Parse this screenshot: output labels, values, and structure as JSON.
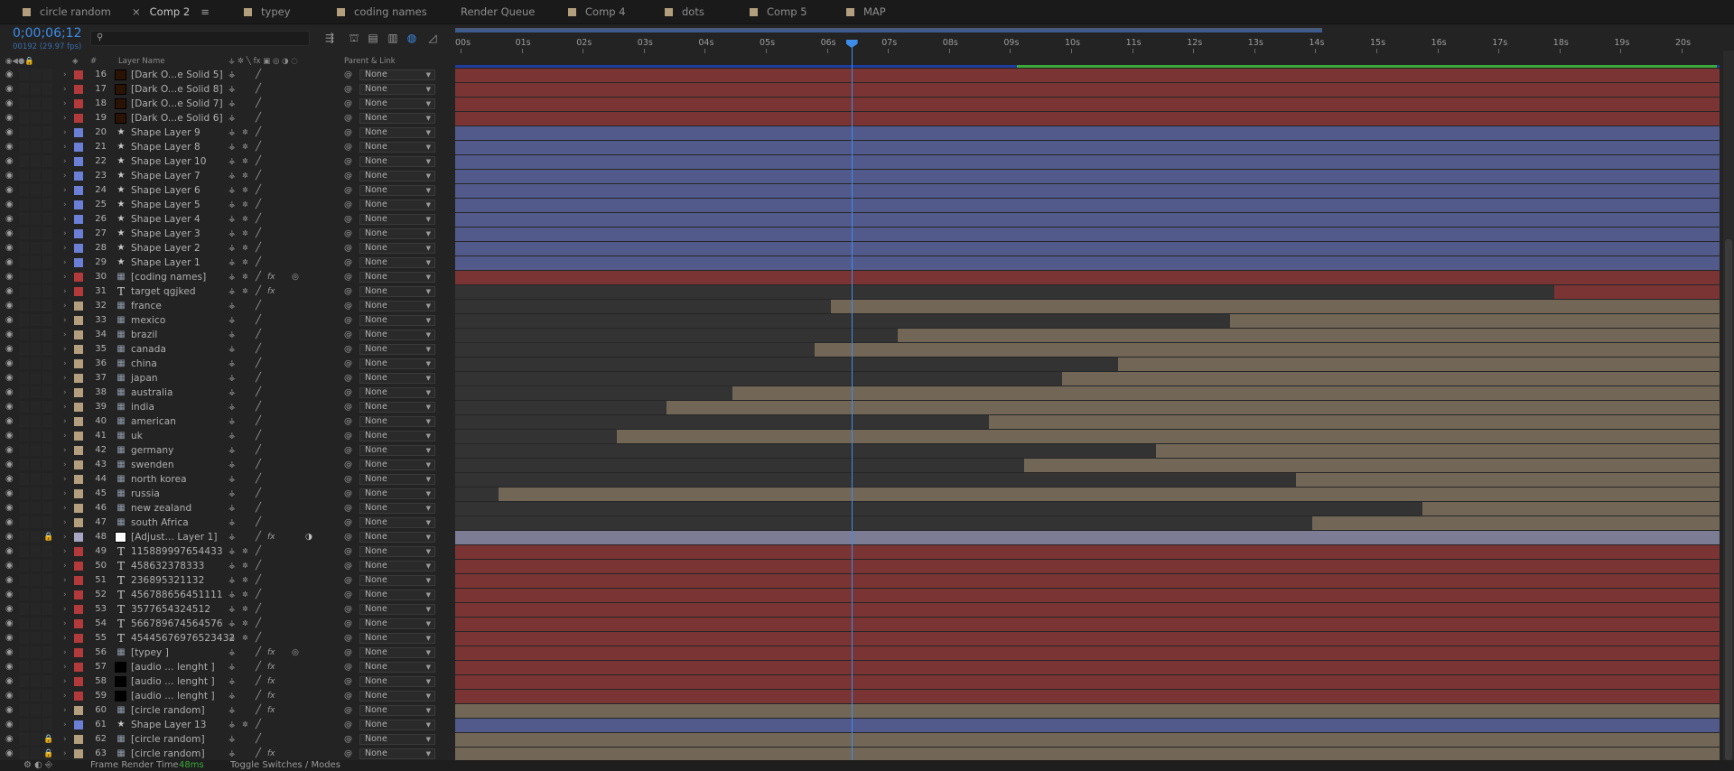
{
  "tabs": [
    {
      "label": "circle random",
      "color": "#b39f7d",
      "active": false
    },
    {
      "label": "Comp 2",
      "color": "#b39f7d",
      "active": true
    },
    {
      "label": "typey",
      "color": "#b39f7d",
      "active": false
    },
    {
      "label": "coding names",
      "color": "#b39f7d",
      "active": false
    },
    {
      "label": "Render Queue",
      "color": "",
      "active": false
    },
    {
      "label": "Comp 4",
      "color": "#b39f7d",
      "active": false
    },
    {
      "label": "dots",
      "color": "#b39f7d",
      "active": false
    },
    {
      "label": "Comp 5",
      "color": "#b39f7d",
      "active": false
    },
    {
      "label": "MAP",
      "color": "#b39f7d",
      "active": false
    }
  ],
  "header": {
    "timecode": "0;00;06;12",
    "frame_info": "00192 (29.97 fps)",
    "search_placeholder": ""
  },
  "columns": {
    "hash": "#",
    "layer_name": "Layer Name",
    "parent_link": "Parent & Link"
  },
  "ruler_ticks": [
    "00s",
    "01s",
    "02s",
    "03s",
    "04s",
    "05s",
    "06s",
    "07s",
    "08s",
    "09s",
    "10s",
    "11s",
    "12s",
    "13s",
    "14s",
    "15s",
    "16s",
    "17s",
    "18s",
    "19s",
    "20s"
  ],
  "playhead_seconds": 6.4,
  "duration_seconds": 20.6,
  "layers": [
    {
      "num": "16",
      "name": "[Dark O...e Solid 5]",
      "icon": "solid",
      "label": "#b23a3a",
      "sw": "solid",
      "fx": false,
      "bar": {
        "start": 0,
        "end": 1,
        "color": "#7a3434"
      }
    },
    {
      "num": "17",
      "name": "[Dark O...e Solid 8]",
      "icon": "solid",
      "label": "#b23a3a",
      "sw": "solid",
      "fx": false,
      "bar": {
        "start": 0,
        "end": 1,
        "color": "#7a3434"
      }
    },
    {
      "num": "18",
      "name": "[Dark O...e Solid 7]",
      "icon": "solid",
      "label": "#b23a3a",
      "sw": "solid",
      "fx": false,
      "bar": {
        "start": 0,
        "end": 1,
        "color": "#7a3434"
      }
    },
    {
      "num": "19",
      "name": "[Dark O...e Solid 6]",
      "icon": "solid",
      "label": "#b23a3a",
      "sw": "solid",
      "fx": false,
      "bar": {
        "start": 0,
        "end": 1,
        "color": "#7a3434"
      }
    },
    {
      "num": "20",
      "name": "Shape Layer 9",
      "icon": "star",
      "label": "#6b7fd6",
      "sw": "shape",
      "fx": false,
      "bar": {
        "start": 0,
        "end": 1,
        "color": "#515a8a"
      }
    },
    {
      "num": "21",
      "name": "Shape Layer 8",
      "icon": "star",
      "label": "#6b7fd6",
      "sw": "shape",
      "fx": false,
      "bar": {
        "start": 0,
        "end": 1,
        "color": "#515a8a"
      }
    },
    {
      "num": "22",
      "name": "Shape Layer 10",
      "icon": "star",
      "label": "#6b7fd6",
      "sw": "shape",
      "fx": false,
      "bar": {
        "start": 0,
        "end": 1,
        "color": "#515a8a"
      }
    },
    {
      "num": "23",
      "name": "Shape Layer 7",
      "icon": "star",
      "label": "#6b7fd6",
      "sw": "shape",
      "fx": false,
      "bar": {
        "start": 0,
        "end": 1,
        "color": "#515a8a"
      }
    },
    {
      "num": "24",
      "name": "Shape Layer 6",
      "icon": "star",
      "label": "#6b7fd6",
      "sw": "shape",
      "fx": false,
      "bar": {
        "start": 0,
        "end": 1,
        "color": "#515a8a"
      }
    },
    {
      "num": "25",
      "name": "Shape Layer 5",
      "icon": "star",
      "label": "#6b7fd6",
      "sw": "shape",
      "fx": false,
      "bar": {
        "start": 0,
        "end": 1,
        "color": "#515a8a"
      }
    },
    {
      "num": "26",
      "name": "Shape Layer 4",
      "icon": "star",
      "label": "#6b7fd6",
      "sw": "shape",
      "fx": false,
      "bar": {
        "start": 0,
        "end": 1,
        "color": "#515a8a"
      }
    },
    {
      "num": "27",
      "name": "Shape Layer 3",
      "icon": "star",
      "label": "#6b7fd6",
      "sw": "shape",
      "fx": false,
      "bar": {
        "start": 0,
        "end": 1,
        "color": "#515a8a"
      }
    },
    {
      "num": "28",
      "name": "Shape Layer 2",
      "icon": "star",
      "label": "#6b7fd6",
      "sw": "shape",
      "fx": false,
      "bar": {
        "start": 0,
        "end": 1,
        "color": "#515a8a"
      }
    },
    {
      "num": "29",
      "name": "Shape Layer 1",
      "icon": "star",
      "label": "#6b7fd6",
      "sw": "shape",
      "fx": false,
      "bar": {
        "start": 0,
        "end": 1,
        "color": "#515a8a"
      }
    },
    {
      "num": "30",
      "name": "[coding names]",
      "icon": "comp",
      "label": "#b23a3a",
      "sw": "shape",
      "fx": true,
      "mb": true,
      "bar": {
        "start": 0,
        "end": 1,
        "color": "#7a3434"
      }
    },
    {
      "num": "31",
      "name": "target   qgjked",
      "icon": "text",
      "label": "#b23a3a",
      "sw": "shape",
      "fx": true,
      "bar": {
        "start": 0.869,
        "end": 1,
        "color": "#7a3434"
      }
    },
    {
      "num": "32",
      "name": "france",
      "icon": "comp",
      "label": "#b39f7d",
      "sw": "solid",
      "fx": false,
      "bar": {
        "start": 0.297,
        "end": 1,
        "color": "#726757"
      }
    },
    {
      "num": "33",
      "name": "mexico",
      "icon": "comp",
      "label": "#b39f7d",
      "sw": "solid",
      "fx": false,
      "bar": {
        "start": 0.613,
        "end": 1,
        "color": "#726757"
      }
    },
    {
      "num": "34",
      "name": "brazil",
      "icon": "comp",
      "label": "#b39f7d",
      "sw": "solid",
      "fx": false,
      "bar": {
        "start": 0.35,
        "end": 1,
        "color": "#726757"
      }
    },
    {
      "num": "35",
      "name": "canada",
      "icon": "comp",
      "label": "#b39f7d",
      "sw": "solid",
      "fx": false,
      "bar": {
        "start": 0.284,
        "end": 1,
        "color": "#726757"
      }
    },
    {
      "num": "36",
      "name": "china",
      "icon": "comp",
      "label": "#b39f7d",
      "sw": "solid",
      "fx": false,
      "bar": {
        "start": 0.524,
        "end": 1,
        "color": "#726757"
      }
    },
    {
      "num": "37",
      "name": "japan",
      "icon": "comp",
      "label": "#b39f7d",
      "sw": "solid",
      "fx": false,
      "bar": {
        "start": 0.48,
        "end": 1,
        "color": "#726757"
      }
    },
    {
      "num": "38",
      "name": "australia",
      "icon": "comp",
      "label": "#b39f7d",
      "sw": "solid",
      "fx": false,
      "bar": {
        "start": 0.219,
        "end": 1,
        "color": "#726757"
      }
    },
    {
      "num": "39",
      "name": "india",
      "icon": "comp",
      "label": "#b39f7d",
      "sw": "solid",
      "fx": false,
      "bar": {
        "start": 0.167,
        "end": 1,
        "color": "#726757"
      }
    },
    {
      "num": "40",
      "name": "american",
      "icon": "comp",
      "label": "#b39f7d",
      "sw": "solid",
      "fx": false,
      "bar": {
        "start": 0.422,
        "end": 1,
        "color": "#726757"
      }
    },
    {
      "num": "41",
      "name": "uk",
      "icon": "comp",
      "label": "#b39f7d",
      "sw": "solid",
      "fx": false,
      "bar": {
        "start": 0.128,
        "end": 1,
        "color": "#726757"
      }
    },
    {
      "num": "42",
      "name": "germany",
      "icon": "comp",
      "label": "#b39f7d",
      "sw": "solid",
      "fx": false,
      "bar": {
        "start": 0.554,
        "end": 1,
        "color": "#726757"
      }
    },
    {
      "num": "43",
      "name": "swenden",
      "icon": "comp",
      "label": "#b39f7d",
      "sw": "solid",
      "fx": false,
      "bar": {
        "start": 0.45,
        "end": 1,
        "color": "#726757"
      }
    },
    {
      "num": "44",
      "name": "north korea",
      "icon": "comp",
      "label": "#b39f7d",
      "sw": "solid",
      "fx": false,
      "bar": {
        "start": 0.665,
        "end": 1,
        "color": "#726757"
      }
    },
    {
      "num": "45",
      "name": "russia",
      "icon": "comp",
      "label": "#b39f7d",
      "sw": "solid",
      "fx": false,
      "bar": {
        "start": 0.034,
        "end": 1,
        "color": "#726757"
      }
    },
    {
      "num": "46",
      "name": "new zealand",
      "icon": "comp",
      "label": "#b39f7d",
      "sw": "solid",
      "fx": false,
      "bar": {
        "start": 0.765,
        "end": 1,
        "color": "#726757"
      }
    },
    {
      "num": "47",
      "name": "south Africa",
      "icon": "comp",
      "label": "#b39f7d",
      "sw": "solid",
      "fx": false,
      "bar": {
        "start": 0.678,
        "end": 1,
        "color": "#726757"
      }
    },
    {
      "num": "48",
      "name": "[Adjust... Layer 1]",
      "icon": "white",
      "label": "#a7a7c4",
      "sw": "solid",
      "fx": true,
      "lock": true,
      "adj": true,
      "bar": {
        "start": 0,
        "end": 1,
        "color": "#7c7c94"
      }
    },
    {
      "num": "49",
      "name": "115889997654433",
      "icon": "text",
      "label": "#b23a3a",
      "sw": "shape",
      "fx": false,
      "bar": {
        "start": 0,
        "end": 1,
        "color": "#7a3434"
      }
    },
    {
      "num": "50",
      "name": "458632378333",
      "icon": "text",
      "label": "#b23a3a",
      "sw": "shape",
      "fx": false,
      "bar": {
        "start": 0,
        "end": 1,
        "color": "#7a3434"
      }
    },
    {
      "num": "51",
      "name": "236895321132",
      "icon": "text",
      "label": "#b23a3a",
      "sw": "shape",
      "fx": false,
      "bar": {
        "start": 0,
        "end": 1,
        "color": "#7a3434"
      }
    },
    {
      "num": "52",
      "name": "456788656451111",
      "icon": "text",
      "label": "#b23a3a",
      "sw": "shape",
      "fx": false,
      "bar": {
        "start": 0,
        "end": 1,
        "color": "#7a3434"
      }
    },
    {
      "num": "53",
      "name": "3577654324512",
      "icon": "text",
      "label": "#b23a3a",
      "sw": "shape",
      "fx": false,
      "bar": {
        "start": 0,
        "end": 1,
        "color": "#7a3434"
      }
    },
    {
      "num": "54",
      "name": "566789674564576",
      "icon": "text",
      "label": "#b23a3a",
      "sw": "shape",
      "fx": false,
      "bar": {
        "start": 0,
        "end": 1,
        "color": "#7a3434"
      }
    },
    {
      "num": "55",
      "name": "45445676976523432",
      "icon": "text",
      "label": "#b23a3a",
      "sw": "shape",
      "fx": false,
      "bar": {
        "start": 0,
        "end": 1,
        "color": "#7a3434"
      }
    },
    {
      "num": "56",
      "name": "[typey ]",
      "icon": "comp",
      "label": "#b23a3a",
      "sw": "solid",
      "fx": true,
      "mb": true,
      "bar": {
        "start": 0,
        "end": 1,
        "color": "#7a3434"
      }
    },
    {
      "num": "57",
      "name": "[audio ... lenght ]",
      "icon": "black",
      "label": "#b23a3a",
      "sw": "solid",
      "fx": true,
      "bar": {
        "start": 0,
        "end": 1,
        "color": "#7a3434"
      }
    },
    {
      "num": "58",
      "name": "[audio ... lenght ]",
      "icon": "black",
      "label": "#b23a3a",
      "sw": "solid",
      "fx": true,
      "bar": {
        "start": 0,
        "end": 1,
        "color": "#7a3434"
      }
    },
    {
      "num": "59",
      "name": "[audio ... lenght ]",
      "icon": "black",
      "label": "#b23a3a",
      "sw": "solid",
      "fx": true,
      "bar": {
        "start": 0,
        "end": 1,
        "color": "#7a3434"
      }
    },
    {
      "num": "60",
      "name": "[circle random]",
      "icon": "comp",
      "label": "#b39f7d",
      "sw": "solid",
      "fx": true,
      "bar": {
        "start": 0,
        "end": 1,
        "color": "#726757"
      }
    },
    {
      "num": "61",
      "name": "Shape Layer 13",
      "icon": "star",
      "label": "#6b7fd6",
      "sw": "shape",
      "fx": false,
      "bar": {
        "start": 0,
        "end": 1,
        "color": "#515a8a"
      }
    },
    {
      "num": "62",
      "name": "[circle random]",
      "icon": "comp",
      "label": "#b39f7d",
      "sw": "solid",
      "fx": false,
      "lock": true,
      "bar": {
        "start": 0,
        "end": 1,
        "color": "#726757"
      }
    },
    {
      "num": "63",
      "name": "[circle random]",
      "icon": "comp",
      "label": "#b39f7d",
      "sw": "solid",
      "fx": true,
      "lock": true,
      "bar": {
        "start": 0,
        "end": 1,
        "color": "#726757"
      }
    }
  ],
  "parent_value": "None",
  "status": {
    "render_label": "Frame Render Time",
    "render_value": "48ms",
    "toggle_label": "Toggle Switches / Modes"
  }
}
